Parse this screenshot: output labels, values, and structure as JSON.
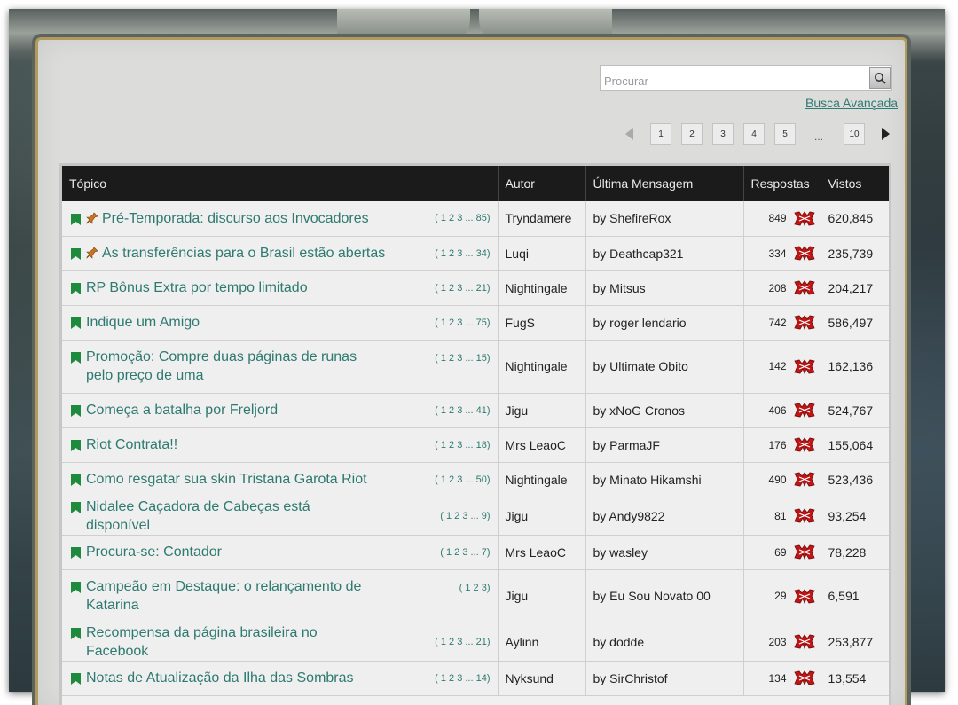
{
  "search": {
    "placeholder": "Procurar"
  },
  "advanced_search_label": "Busca Avançada",
  "pagination": {
    "pages": [
      "1",
      "2",
      "3",
      "4",
      "5"
    ],
    "ellipsis": "...",
    "last": "10"
  },
  "columns": {
    "topic": "Tópico",
    "author": "Autor",
    "last_post": "Última Mensagem",
    "replies": "Respostas",
    "views": "Vistos"
  },
  "rows": [
    {
      "title": "Pré-Temporada: discurso aos Invocadores",
      "pinned": true,
      "pages": "( 1 2 3 ... 85)",
      "author": "Tryndamere",
      "last": "by ShefireRox",
      "replies": "849",
      "views": "620,845"
    },
    {
      "title": "As transferências para o Brasil estão abertas",
      "pinned": true,
      "pages": "( 1 2 3 ... 34)",
      "author": "Luqi",
      "last": "by Deathcap321",
      "replies": "334",
      "views": "235,739"
    },
    {
      "title": "RP Bônus Extra por tempo limitado",
      "pinned": false,
      "pages": "( 1 2 3 ... 21)",
      "author": "Nightingale",
      "last": "by Mitsus",
      "replies": "208",
      "views": "204,217"
    },
    {
      "title": "Indique um Amigo",
      "pinned": false,
      "pages": "( 1 2 3 ... 75)",
      "author": "FugS",
      "last": "by roger lendario",
      "replies": "742",
      "views": "586,497"
    },
    {
      "title": "Promoção: Compre duas páginas de runas pelo preço de uma",
      "pinned": false,
      "pages": "( 1 2 3 ... 15)",
      "author": "Nightingale",
      "last": "by Ultimate Obito",
      "replies": "142",
      "views": "162,136",
      "tall": true
    },
    {
      "title": "Começa a batalha por Freljord",
      "pinned": false,
      "pages": "( 1 2 3 ... 41)",
      "author": "Jigu",
      "last": "by xNoG Cronos",
      "replies": "406",
      "views": "524,767"
    },
    {
      "title": "Riot Contrata!!",
      "pinned": false,
      "pages": "( 1 2 3 ... 18)",
      "author": "Mrs LeaoC",
      "last": "by ParmaJF",
      "replies": "176",
      "views": "155,064"
    },
    {
      "title": "Como resgatar sua skin Tristana Garota Riot",
      "pinned": false,
      "pages": "( 1 2 3 ... 50)",
      "author": "Nightingale",
      "last": "by Minato Hikamshi",
      "replies": "490",
      "views": "523,436"
    },
    {
      "title": "Nidalee Caçadora de Cabeças está disponível",
      "pinned": false,
      "pages": "( 1 2 3 ... 9)",
      "author": "Jigu",
      "last": "by Andy9822",
      "replies": "81",
      "views": "93,254"
    },
    {
      "title": "Procura-se: Contador",
      "pinned": false,
      "pages": "( 1 2 3 ... 7)",
      "author": "Mrs LeaoC",
      "last": "by wasley",
      "replies": "69",
      "views": "78,228"
    },
    {
      "title": "Campeão em Destaque: o relançamento de Katarina",
      "pinned": false,
      "pages": "( 1 2 3)",
      "author": "Jigu",
      "last": "by Eu Sou Novato 00",
      "replies": "29",
      "views": "6,591",
      "tall": true
    },
    {
      "title": "Recompensa da página brasileira no Facebook",
      "pinned": false,
      "pages": "( 1 2 3 ... 21)",
      "author": "Aylinn",
      "last": "by dodde",
      "replies": "203",
      "views": "253,877"
    },
    {
      "title": "Notas de Atualização da Ilha das Sombras",
      "pinned": false,
      "pages": "( 1 2 3 ... 14)",
      "author": "Nyksund",
      "last": "by SirChristof",
      "replies": "134",
      "views": "13,554"
    }
  ],
  "icons": {
    "bookmark": "green-bookmark-icon",
    "pin": "pin-icon",
    "badge": "riot-badge-icon"
  },
  "colors": {
    "link": "#2e7a70",
    "header_bg": "#1b1b1b",
    "bookmark": "#1e8a3e",
    "badge": "#c01515"
  }
}
